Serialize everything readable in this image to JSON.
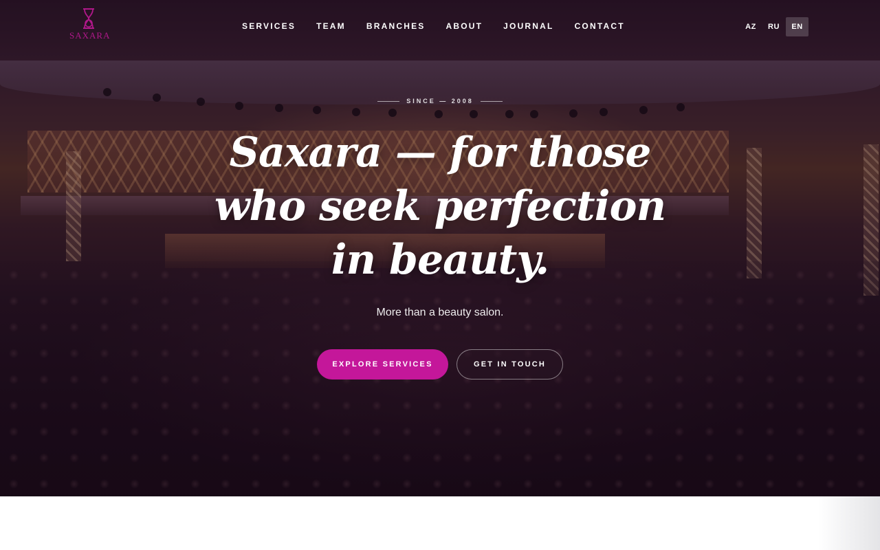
{
  "brand": {
    "name": "SAXARA",
    "logo_icon": "hourglass-icon",
    "color": "#b0188a"
  },
  "nav": {
    "items": [
      {
        "label": "SERVICES"
      },
      {
        "label": "TEAM"
      },
      {
        "label": "BRANCHES"
      },
      {
        "label": "ABOUT"
      },
      {
        "label": "JOURNAL"
      },
      {
        "label": "CONTACT"
      }
    ]
  },
  "languages": {
    "items": [
      {
        "label": "AZ"
      },
      {
        "label": "RU"
      },
      {
        "label": "EN"
      }
    ],
    "active": "EN"
  },
  "hero": {
    "eyebrow": "SINCE — 2008",
    "headline": "Saxara — for those who seek perfection in beauty.",
    "subtitle": "More than a beauty salon.",
    "primary_cta": "EXPLORE SERVICES",
    "secondary_cta": "GET IN TOUCH"
  },
  "colors": {
    "accent": "#c4179a",
    "overlay": "#1f0f1d"
  }
}
